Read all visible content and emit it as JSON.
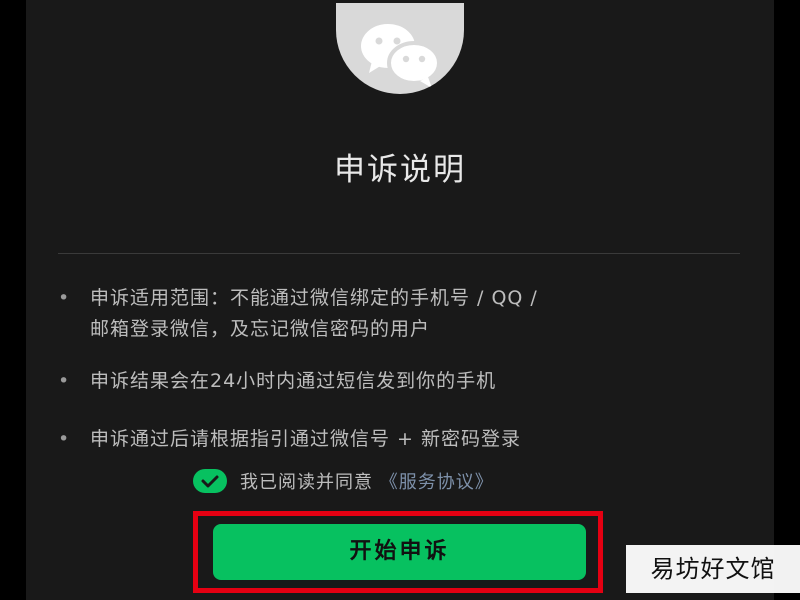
{
  "logo": {
    "icon": "wechat-logo-icon",
    "bg_color": "#d9d9d9"
  },
  "page": {
    "title": "申诉说明"
  },
  "info": {
    "bullets": [
      {
        "line1": "申诉适用范围：不能通过微信绑定的手机号 / QQ /",
        "line2": "邮箱登录微信，及忘记微信密码的用户"
      },
      {
        "line1": "申诉结果会在24小时内通过短信发到你的手机"
      },
      {
        "line1": "申诉通过后请根据指引通过微信号 + 新密码登录"
      }
    ],
    "bullet_mark": "•"
  },
  "agreement": {
    "checked": true,
    "text": "我已阅读并同意",
    "link": "《服务协议》"
  },
  "button": {
    "label": "开始申诉",
    "color": "#07c160"
  },
  "annotation": {
    "highlight_color": "#e50012"
  },
  "watermark": {
    "text": "易坊好文馆"
  }
}
